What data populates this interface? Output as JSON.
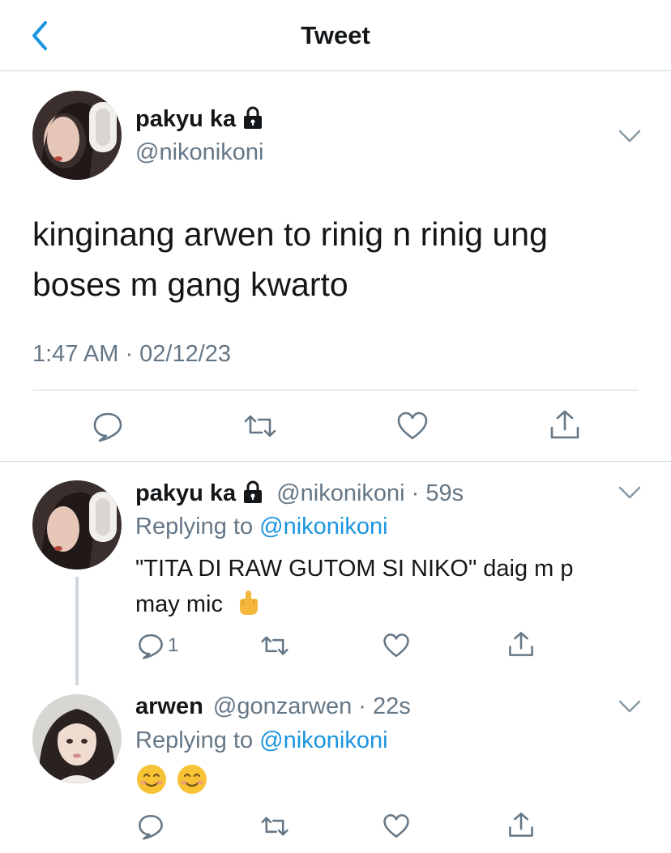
{
  "header": {
    "title": "Tweet"
  },
  "main_tweet": {
    "display_name": "pakyu ka",
    "handle": "@nikonikoni",
    "text_line1": "kinginang arwen to rinig n rinig ung",
    "text_line2": "boses m gang kwarto",
    "timestamp": "1:47 AM · 02/12/23"
  },
  "replies": [
    {
      "display_name": "pakyu ka",
      "meta": "@nikonikoni · 59s",
      "replying_prefix": "Replying to ",
      "replying_to": "@nikonikoni",
      "text_line1": "\"TITA DI RAW GUTOM SI NIKO\" daig m p",
      "text_line2": "may mic",
      "reply_count": "1"
    },
    {
      "display_name": "arwen",
      "meta": "@gonzarwen · 22s",
      "replying_prefix": "Replying to ",
      "replying_to": "@nikonikoni"
    }
  ],
  "icons": {
    "back": "chevron-left-icon",
    "lock": "lock-icon",
    "more": "chevron-down-icon",
    "reply": "comment-icon",
    "retweet": "retweet-icon",
    "like": "heart-icon",
    "share": "share-icon"
  },
  "colors": {
    "accent": "#1b95e0",
    "muted": "#657786",
    "text": "#14171a",
    "divider": "#cfd6dc"
  }
}
